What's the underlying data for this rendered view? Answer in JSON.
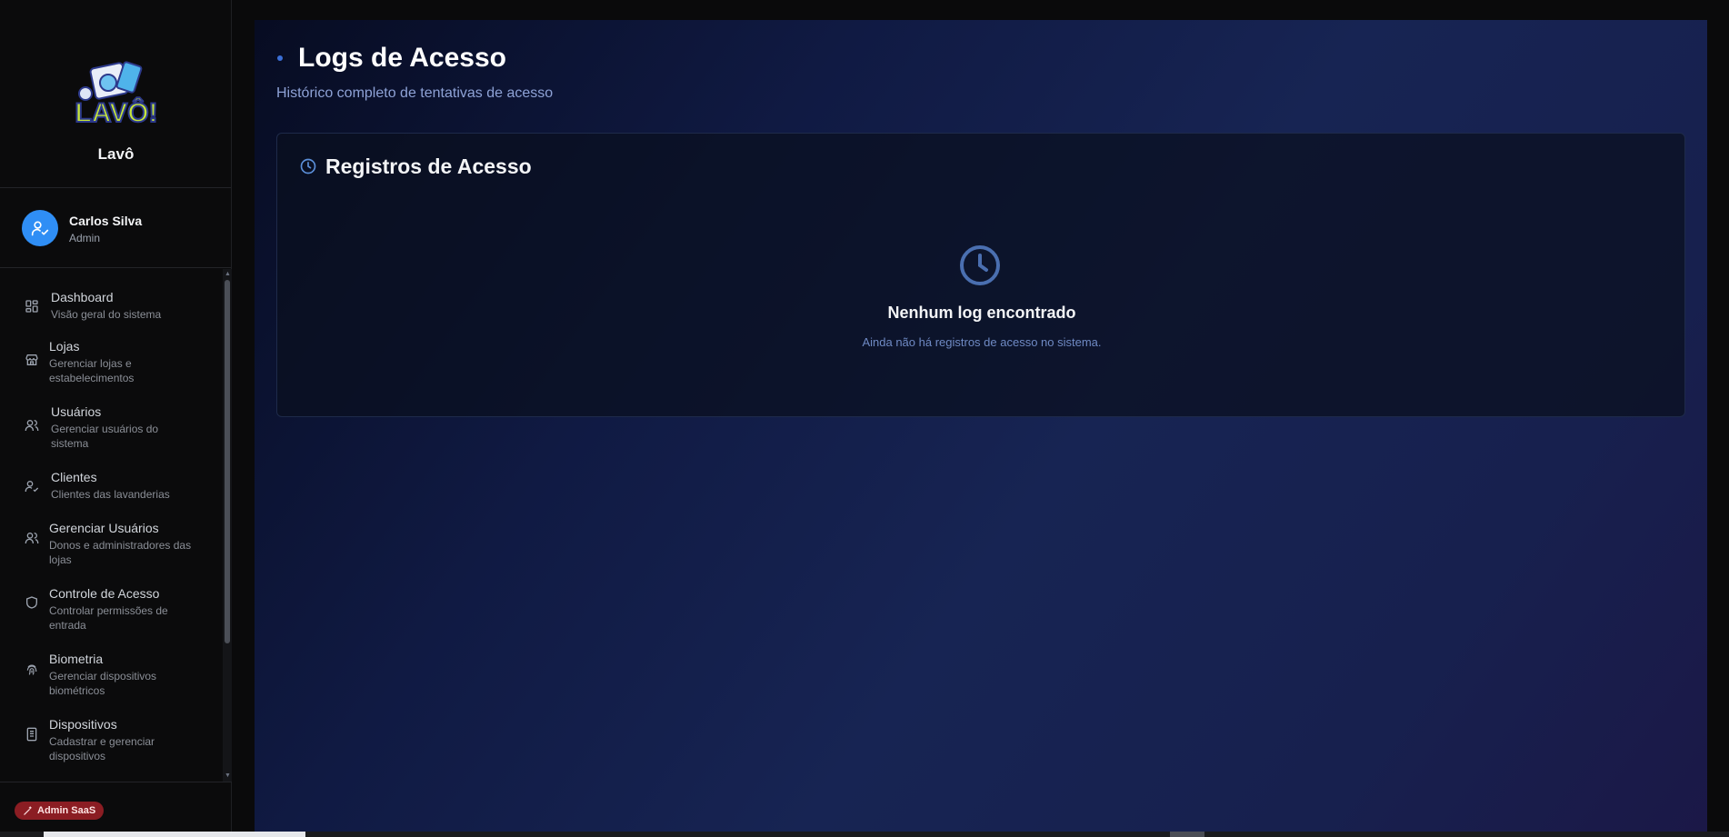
{
  "app": {
    "name": "Lavô",
    "logo_text": "LAVÔ!"
  },
  "user": {
    "name": "Carlos Silva",
    "role": "Admin"
  },
  "sidebar": {
    "items": [
      {
        "label": "Dashboard",
        "desc": "Visão geral do sistema",
        "icon": "dashboard-icon"
      },
      {
        "label": "Lojas",
        "desc": "Gerenciar lojas e estabelecimentos",
        "icon": "store-icon"
      },
      {
        "label": "Usuários",
        "desc": "Gerenciar usuários do sistema",
        "icon": "users-icon"
      },
      {
        "label": "Clientes",
        "desc": "Clientes das lavanderias",
        "icon": "user-check-icon"
      },
      {
        "label": "Gerenciar Usuários",
        "desc": "Donos e administradores das lojas",
        "icon": "users-icon"
      },
      {
        "label": "Controle de Acesso",
        "desc": "Controlar permissões de entrada",
        "icon": "shield-icon"
      },
      {
        "label": "Biometria",
        "desc": "Gerenciar dispositivos biométricos",
        "icon": "fingerprint-icon"
      },
      {
        "label": "Dispositivos",
        "desc": "Cadastrar e gerenciar dispositivos",
        "icon": "device-icon"
      }
    ],
    "footer_badge": "Admin SaaS"
  },
  "main": {
    "title": "Logs de Acesso",
    "subtitle": "Histórico completo de tentativas de acesso",
    "card": {
      "title": "Registros de Acesso",
      "empty_title": "Nenhum log encontrado",
      "empty_desc": "Ainda não há registros de acesso no sistema."
    }
  },
  "colors": {
    "accent": "#2f8ef5",
    "badge": "#8b1d23",
    "icon_blue": "#5b8fd9"
  }
}
